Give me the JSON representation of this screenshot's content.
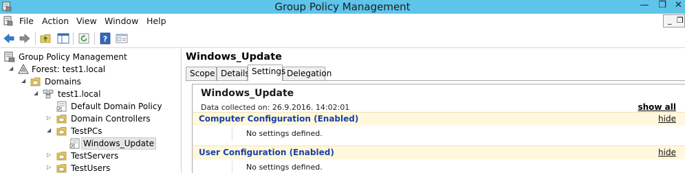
{
  "window": {
    "title": "Group Policy Management",
    "min_glyph": "—",
    "max_glyph": "❐",
    "close_glyph": "✕"
  },
  "menu": {
    "items": [
      "File",
      "Action",
      "View",
      "Window",
      "Help"
    ],
    "mdi_min": "_",
    "mdi_restore": "❐"
  },
  "toolbar": {
    "icons": [
      "back-arrow-icon",
      "forward-arrow-icon",
      "up-folder-icon",
      "show-hide-tree-icon",
      "refresh-icon",
      "help-icon",
      "properties-icon"
    ]
  },
  "tree": {
    "root": "Group Policy Management",
    "forest": "Forest: test1.local",
    "domains": "Domains",
    "domain": "test1.local",
    "default_policy": "Default Domain Policy",
    "domain_controllers": "Domain Controllers",
    "testpcs": "TestPCs",
    "windows_update": "Windows_Update",
    "testservers": "TestServers",
    "testusers": "TestUsers"
  },
  "main": {
    "title": "Windows_Update",
    "tabs": [
      "Scope",
      "Details",
      "Settings",
      "Delegation"
    ],
    "active_tab": "Settings",
    "report": {
      "title": "Windows_Update",
      "date": "Data collected on: 26.9.2016. 14:02:01",
      "show_all": "show all",
      "sections": [
        {
          "label": "Computer Configuration (Enabled)",
          "hide": "hide",
          "body": "No settings defined."
        },
        {
          "label": "User Configuration (Enabled)",
          "hide": "hide",
          "body": "No settings defined."
        }
      ]
    }
  },
  "colors": {
    "titlebar": "#5ec4ea",
    "section_header_bg": "#fff8dc",
    "section_header_text": "#1a3fa8"
  }
}
